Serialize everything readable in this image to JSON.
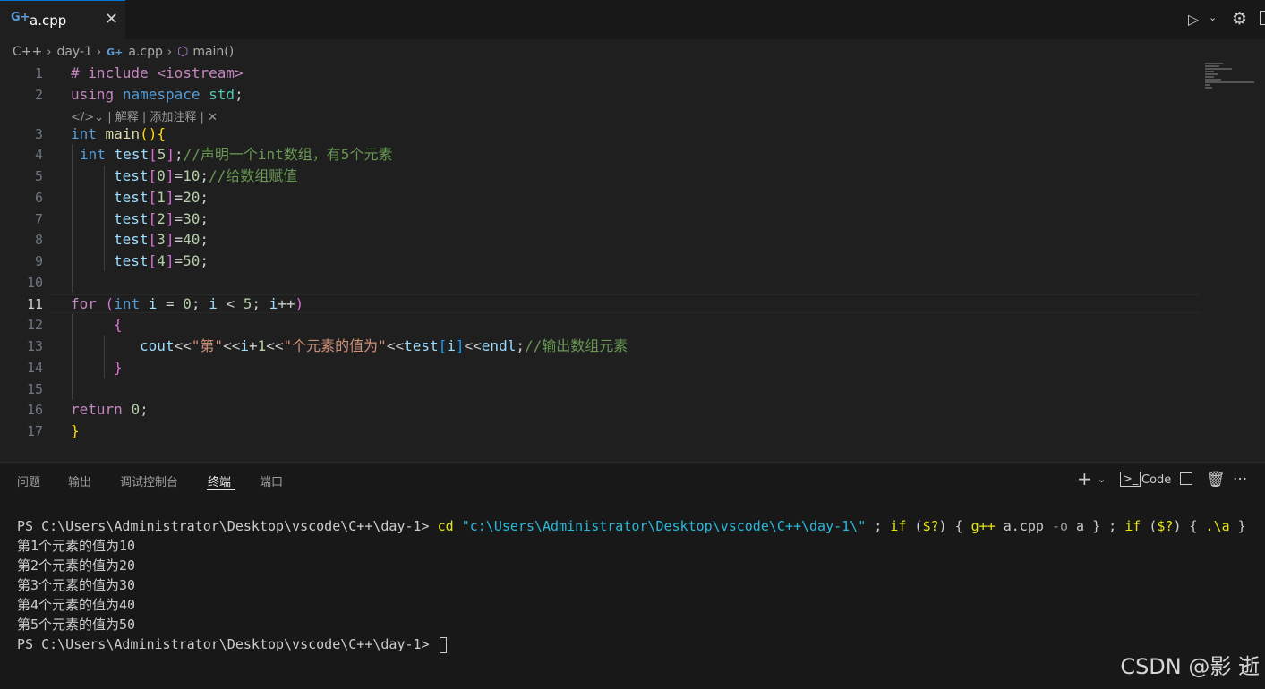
{
  "tab": {
    "filename": "a.cpp",
    "close_glyph": "✕"
  },
  "breadcrumb": {
    "items": [
      "C++",
      "day-1",
      "a.cpp",
      "main()"
    ]
  },
  "codelens": {
    "text": "| 解释 | 添加注释 | ✕"
  },
  "editor": {
    "active_line": 11,
    "line_numbers": [
      "1",
      "2",
      "3",
      "4",
      "5",
      "6",
      "7",
      "8",
      "9",
      "10",
      "11",
      "12",
      "13",
      "14",
      "15",
      "16",
      "17"
    ]
  },
  "panel": {
    "tabs": [
      "问题",
      "输出",
      "调试控制台",
      "终端",
      "端口"
    ],
    "active_tab": "终端",
    "terminal_profile_label": "Code"
  },
  "terminal": {
    "prompt": "PS C:\\Users\\Administrator\\Desktop\\vscode\\C++\\day-1>",
    "cmd": "cd",
    "path_arg": "\"c:\\Users\\Administrator\\Desktop\\vscode\\C++\\day-1\\\"",
    "output": [
      "第1个元素的值为10",
      "第2个元素的值为20",
      "第3个元素的值为30",
      "第4个元素的值为40",
      "第5个元素的值为50"
    ]
  },
  "watermark": "CSDN @影 逝",
  "icons": [
    "cpp-file-icon",
    "close-icon",
    "run-icon",
    "chevron-down-icon",
    "gear-icon",
    "split-editor-icon",
    "cube-icon",
    "codelens-icon",
    "add-terminal-icon",
    "terminal-icon",
    "split-terminal-icon",
    "trash-icon",
    "more-icon"
  ]
}
